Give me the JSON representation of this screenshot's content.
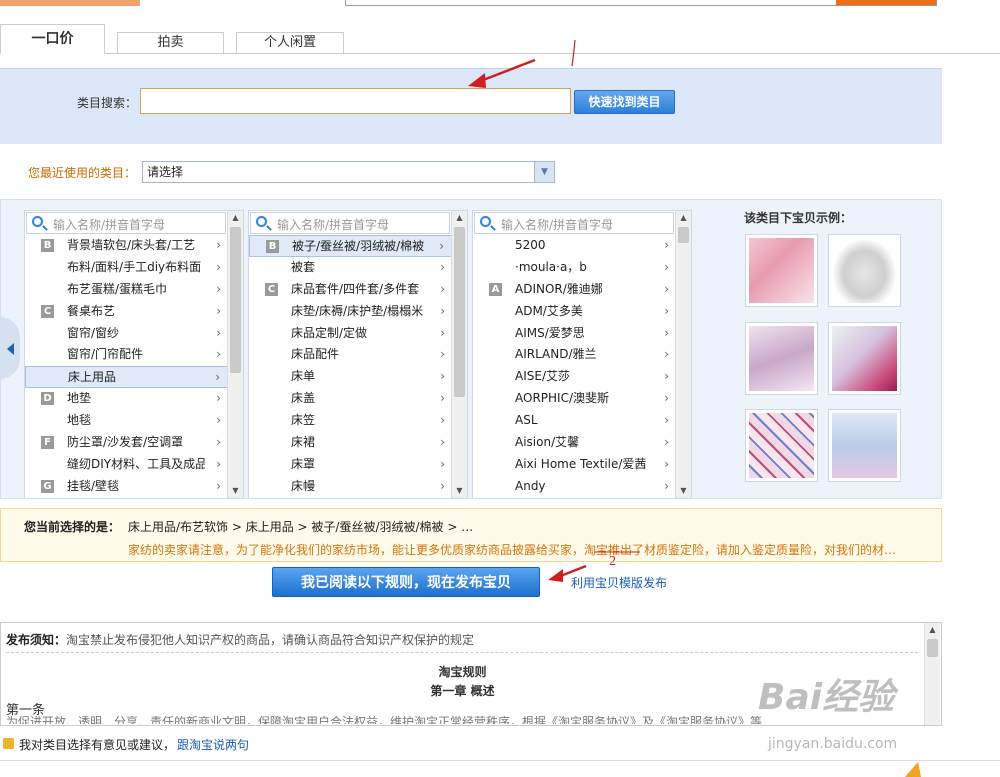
{
  "tabs": [
    "一口价",
    "拍卖",
    "个人闲置"
  ],
  "search": {
    "label": "类目搜索：",
    "value": "",
    "button": "快速找到类目"
  },
  "recent": {
    "label": "您最近使用的类目：",
    "selected": "请选择"
  },
  "columns": [
    {
      "placeholder": "输入名称/拼音首字母",
      "items": [
        {
          "letter": "B",
          "label": "背景墙软包/床头套/工艺"
        },
        {
          "letter": "",
          "label": "布料/面料/手工diy布料面"
        },
        {
          "letter": "",
          "label": "布艺蛋糕/蛋糕毛巾"
        },
        {
          "letter": "C",
          "label": "餐桌布艺"
        },
        {
          "letter": "",
          "label": "窗帘/窗纱"
        },
        {
          "letter": "",
          "label": "窗帘/门帘配件"
        },
        {
          "letter": "",
          "label": "床上用品",
          "selected": true
        },
        {
          "letter": "D",
          "label": "地垫"
        },
        {
          "letter": "",
          "label": "地毯"
        },
        {
          "letter": "F",
          "label": "防尘罩/沙发套/空调罩"
        },
        {
          "letter": "",
          "label": "缝纫DIY材料、工具及成品"
        },
        {
          "letter": "G",
          "label": "挂毯/壁毯"
        }
      ]
    },
    {
      "placeholder": "输入名称/拼音首字母",
      "items": [
        {
          "letter": "B",
          "label": "被子/蚕丝被/羽绒被/棉被",
          "selected": true
        },
        {
          "letter": "",
          "label": "被套"
        },
        {
          "letter": "C",
          "label": "床品套件/四件套/多件套"
        },
        {
          "letter": "",
          "label": "床垫/床褥/床护垫/榻榻米"
        },
        {
          "letter": "",
          "label": "床品定制/定做"
        },
        {
          "letter": "",
          "label": "床品配件"
        },
        {
          "letter": "",
          "label": "床单"
        },
        {
          "letter": "",
          "label": "床盖"
        },
        {
          "letter": "",
          "label": "床笠"
        },
        {
          "letter": "",
          "label": "床裙"
        },
        {
          "letter": "",
          "label": "床罩"
        },
        {
          "letter": "",
          "label": "床幔"
        }
      ]
    },
    {
      "placeholder": "输入名称/拼音首字母",
      "items": [
        {
          "letter": "",
          "label": "5200"
        },
        {
          "letter": "",
          "label": "·moula·a，b"
        },
        {
          "letter": "A",
          "label": "ADINOR/雅迪娜"
        },
        {
          "letter": "",
          "label": "ADM/艾多美"
        },
        {
          "letter": "",
          "label": "AIMS/爱梦思"
        },
        {
          "letter": "",
          "label": "AIRLAND/雅兰"
        },
        {
          "letter": "",
          "label": "AISE/艾莎"
        },
        {
          "letter": "",
          "label": "AORPHIC/澳斐斯"
        },
        {
          "letter": "",
          "label": "ASL"
        },
        {
          "letter": "",
          "label": "Aision/艾馨"
        },
        {
          "letter": "",
          "label": "Aixi Home Textile/爱茜"
        },
        {
          "letter": "",
          "label": "Andy"
        }
      ]
    }
  ],
  "examples": {
    "title": "该类目下宝贝示例："
  },
  "current": {
    "label": "您当前选择的是：",
    "path": "床上用品/布艺软饰 > 床上用品 > 被子/蚕丝被/羽绒被/棉被 > …",
    "notice": "家纺的卖家请注意，为了能净化我们的家纺市场，能让更多优质家纺商品披露给买家，淘宝推出了材质鉴定险，请加入鉴定质量险，对我们的材…"
  },
  "publish": {
    "button": "我已阅读以下规则，现在发布宝贝",
    "template_link": "利用宝贝模版发布"
  },
  "rules": {
    "head_label": "发布须知：",
    "head_text": "淘宝禁止发布侵犯他人知识产权的商品，请确认商品符合知识产权保护的规定",
    "title": "淘宝规则",
    "chapter": "第一章 概述",
    "article": "第一条",
    "more": "为促进开放、透明、分享、责任的新商业文明，保障淘宝用户合法权益，维护淘宝正常经营秩序，根据《淘宝服务协议》及《淘宝服务协议》等"
  },
  "feedback": {
    "text": "我对类目选择有意见或建议，",
    "link": "跟淘宝说两句"
  },
  "watermark": {
    "logo": "Bai经验",
    "url": "jingyan.baidu.com"
  },
  "annotation": {
    "mark": "2"
  },
  "colors": {
    "accent_blue": "#2d7fd9",
    "notice_orange": "#d2740d",
    "search_bg": "#dce7fa",
    "annotation_red": "#d01f1f"
  }
}
